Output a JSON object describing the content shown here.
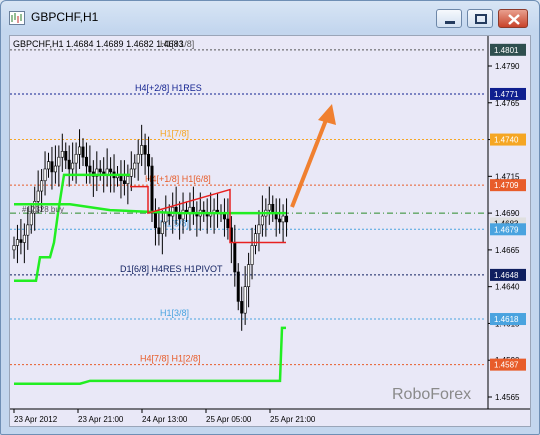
{
  "window": {
    "title": "GBPCHF,H1"
  },
  "chart": {
    "header": "GBPCHF,H1  1.4684 1.4689 1.4682 1.4683",
    "watermark": "RoboForex",
    "y_ticks": [
      "1.4790",
      "1.4765",
      "1.4740",
      "1.4715",
      "1.4690",
      "1.4665",
      "1.4640",
      "1.4615",
      "1.4590",
      "1.4565"
    ],
    "x_ticks": [
      "23 Apr 2012",
      "23 Apr 21:00",
      "24 Apr 13:00",
      "25 Apr 05:00",
      "25 Apr 21:00"
    ],
    "price_badges": [
      {
        "value": "1.4801",
        "color": "#2f4f4f",
        "text_color": "#ffffff"
      },
      {
        "value": "1.4771",
        "color": "#0f1f8f",
        "text_color": "#ffffff"
      },
      {
        "value": "1.4740",
        "color": "#f5a623",
        "text_color": "#ffffff"
      },
      {
        "value": "1.4709",
        "color": "#e85c2a",
        "text_color": "#ffffff"
      },
      {
        "value": "1.4683",
        "color": "#e0e0e0",
        "text_color": "#000000"
      },
      {
        "value": "1.4679",
        "color": "#4aa3df",
        "text_color": "#ffffff"
      },
      {
        "value": "1.4648",
        "color": "#0f1f5f",
        "text_color": "#ffffff"
      },
      {
        "value": "1.4618",
        "color": "#4aa3df",
        "text_color": "#ffffff"
      },
      {
        "value": "1.4587",
        "color": "#e85c2a",
        "text_color": "#ffffff"
      }
    ],
    "levels": [
      {
        "label": "H1[+1/8]",
        "price": 1.4801,
        "color": "#555555"
      },
      {
        "label": "H4[+2/8] H1RES",
        "price": 1.4771,
        "color": "#0f1f8f"
      },
      {
        "label": "H1[7/8]",
        "price": 1.474,
        "color": "#f5a623"
      },
      {
        "label": "H4[+1/8] H1[6/8]",
        "price": 1.4709,
        "color": "#e85c2a"
      },
      {
        "label": "H1[5/8]",
        "price": 1.4679,
        "color": "#4aa3df"
      },
      {
        "label": "D1[6/8] H4RES H1PIVOT",
        "price": 1.4648,
        "color": "#0f1f5f"
      },
      {
        "label": "H1[3/8]",
        "price": 1.4618,
        "color": "#4aa3df"
      },
      {
        "label": "H4[7/8] H1[2/8]",
        "price": 1.4587,
        "color": "#e85c2a"
      }
    ],
    "partial_label": "#12328 buy",
    "accent_arrow_color": "#f08030",
    "green_color": "#22ee22",
    "red_color": "#e82020"
  }
}
